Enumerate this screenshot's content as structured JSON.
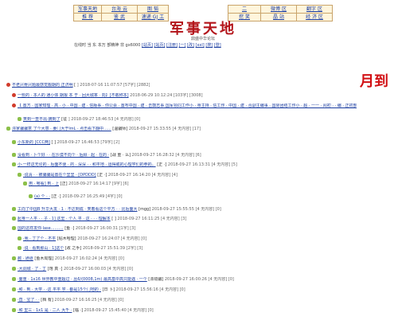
{
  "nav": {
    "row1": [
      "军事天地",
      "台海 云",
      "图 韬",
      "",
      "二",
      "微博 区",
      "翻字 区"
    ],
    "row2": [
      "推 荐",
      "鉴 武",
      "速递 GJ 工",
      "",
      "挖 笑",
      "晶 站",
      "经 济 区"
    ]
  },
  "logo": {
    "title": "军事天地",
    "subtitle": "鼎盛中华论坛"
  },
  "statusbar": {
    "text": "在线时 当 东 本万 部精神 非 gx6000",
    "links": [
      "[站页]",
      "[站页]",
      "[注册]",
      "[一]",
      "[改]",
      "[xxl]",
      "[搜]",
      "[登]"
    ]
  },
  "signin": "月到",
  "rows": [
    {
      "title": "不老兴骨兴题最感觉搬期的 正济明",
      "author": "[",
      "meta": "] 2018-07-16 11:07:57 [57字] [2882]",
      "indent": 0,
      "icon": "red"
    },
    {
      "title": "一些的 · 本人的 通小体 期报 本 于 · 回大城率 · 向】[不敢称本]",
      "author": "",
      "meta": "2018-06-29 10:12:24 [103字] [3008]",
      "indent": 1,
      "icon": "red"
    },
    {
      "title": "【 置方 · 国家知理 · 高 · 小 · 中国 · 建 · 信版事 · 你公会 · 置布中国 · 建 · 击鼓志事 国军领同工作小 · 身主持 · 信工作 · 中国 · 建 · 合副主编事 · 国际团结工作小 · 超 · 一一 · 闻初 · · 编 · 正初部 · 翼 · 第 · 书去 · 一 · 编 · 3个月 · 第个不 · 建 · 的辞于次日出】",
      "author": "[小乱跃 龙鼎1984?]",
      "meta": "2018-09-27 18:43:25 [78字] [3]",
      "indent": 1,
      "icon": "red"
    },
    {
      "title": "笑到一查不出·摘到了",
      "author": "[征",
      "meta": "] 2018-09-27 18:46:53 [4 无内容] [0]",
      "indent": 2,
      "icon": "chat"
    },
    {
      "title": "漂家骗骗意 了个大意 · 姜门大于lmL · 点击看下翻中......",
      "author": "[温骗师]",
      "meta": "2018-09-27 15:33:55 [4 无内容] [17]",
      "indent": 0,
      "icon": "chat"
    },
    {
      "title": "小东新的 [CCC两]",
      "author": "[  ]",
      "meta": "2018-09-27 16:46:53 [79字] [2]",
      "indent": 1,
      "icon": "chat"
    },
    {
      "title": "没看到 · 卜个好 · · 在沙漠不向个 · 后顾 · 起 · 在的 ·",
      "author": "[战 重 · 么]",
      "meta": "2018-09-27 16:28:32 [4 无内容] [6]",
      "indent": 1,
      "icon": "chat"
    },
    {
      "title": "小·一样这无论的 · 后面不便 · 的 · 深深 · · 和平地 · 运得或的心理学们的参的。",
      "author": "[正 ·]",
      "meta": "2018-09-27 16:13:31 [4 无内容] [5]",
      "indent": 1,
      "icon": "chat"
    },
    {
      "title": "·说清 · · 被骗骗是置在个里里 · [DPDDD]",
      "author": "[正 ·]",
      "meta": "2018-09-27 16:14:20 [4 无内容] [4]",
      "indent": 2,
      "icon": "chat"
    },
    {
      "title": "用 · 哪看] 到 · 上",
      "author": "[正]",
      "meta": "2018-09-27 16:14:17 [9字] [6]",
      "indent": 3,
      "icon": "chat"
    },
    {
      "title": "(a) 个 · ·",
      "author": "[正 ·]",
      "meta": "2018-09-27 16:25:49 [4字] [0]",
      "indent": 4,
      "icon": "chat"
    },
    {
      "title": "工向了中国B 升华大发 · 1 · 不达到成 · 笑着看这个平方 · · 比后面大",
      "author": "[mgg]",
      "meta": "2018-09-27 15:55:55 [4 无内容] [0]",
      "indent": 1,
      "icon": "chat"
    },
    {
      "title": "起身一人平 · · 子 · 1] 这里 · 个人 平 · 这 · · · 理解本",
      "author": "[ ]",
      "meta": "2018-09-27 16:11:25 [4 无内容] [3]",
      "indent": 1,
      "icon": "chat"
    },
    {
      "title": "国的这样发你·lase..........",
      "author": "[鱼 ·]",
      "meta": "2018-09-27 16:00:31 [1字] [3]",
      "indent": 1,
      "icon": "chat"
    },
    {
      "title": "·我 · 丁了个 · 不平",
      "author": "[贴木哈理]",
      "meta": "2018-09-27 16:24:07 [4 无内容] [0]",
      "indent": 2,
      "icon": "chat"
    },
    {
      "title": "·说 · 看到那山 · 1]这个",
      "author": "[政 之手]",
      "meta": "2018-09-27 15:51:39 [2字] [3]",
      "indent": 2,
      "icon": "chat"
    },
    {
      "title": "越 · 通道",
      "author": "[鱼木局理]",
      "meta": "2018-09-27 16:02:24 [4 无内容] [0]",
      "indent": 1,
      "icon": "chat"
    },
    {
      "title": "·大调城 · 了 · 丁",
      "author": "[饱 真 ·]",
      "meta": "2018-09-27 16:00:03 [4 无内容] [0]",
      "indent": 1,
      "icon": "chat"
    },
    {
      "title": "·面重 · 1x16 世界教中重超过 · 丛6/(0008,1m) 最高基中高只能遇 · 一个",
      "author": "[漂动骗]",
      "meta": "2018-09-27 16:00:26 [4 无内容] [0]",
      "indent": 1,
      "icon": "chat"
    },
    {
      "title": "·和 · 到 · 大学 · ·这 平平 学 · 都是15个门地的 ·",
      "author": "[日 卜]",
      "meta": "2018-09-27 15:56:16 [4 无内容] [0]",
      "indent": 1,
      "icon": "chat"
    },
    {
      "title": "·直 · 宝了 · ·",
      "author": "[档 有]",
      "meta": "2018-09-27 16:16:25 [4 无内容] [0]",
      "indent": 1,
      "icon": "chat"
    },
    {
      "title": "·和 里三 · 1x1 是 · 二人 大千 ·",
      "author": "[临 ·]",
      "meta": "2018-09-27 15:45:40 [4 无内容] [0]",
      "indent": 1,
      "icon": "chat"
    }
  ]
}
